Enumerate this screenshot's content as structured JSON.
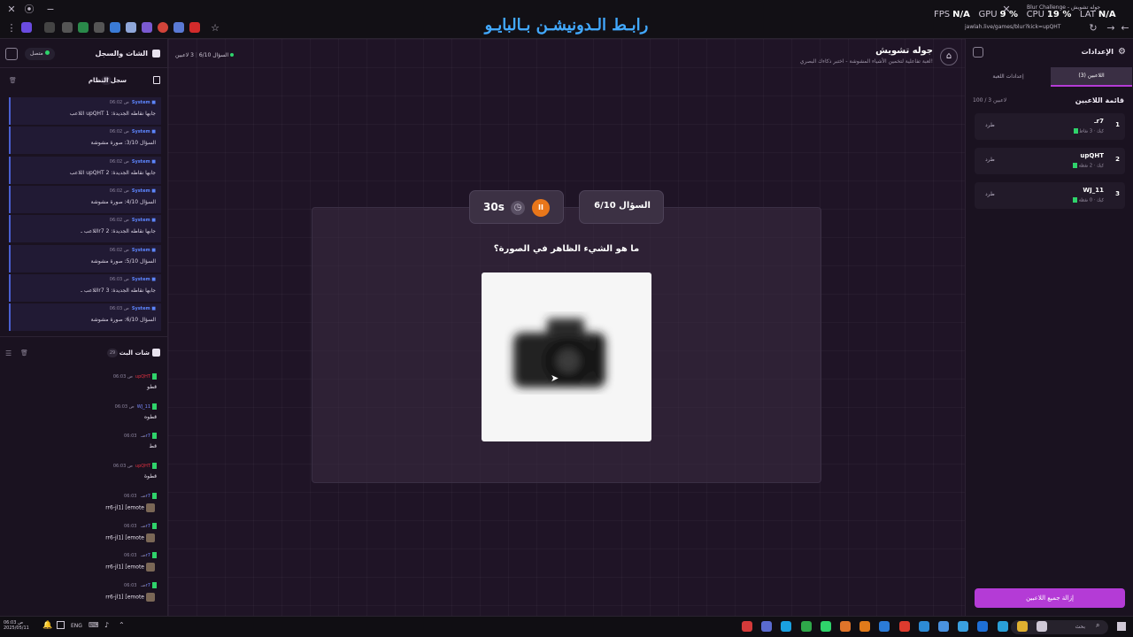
{
  "browser": {
    "banner": "رابـط الـدونيشـن بـالبايـو",
    "tab_title": "Blur Challenge - جوله تشويش",
    "url": "jawlah.live/games/blur?kick=upQHT",
    "stats": {
      "fps_label": "FPS",
      "fps_value": "N/A",
      "gpu_label": "GPU",
      "gpu_value": "9 %",
      "cpu_label": "CPU",
      "cpu_value": "19 %",
      "lat_label": "LAT",
      "lat_value": "N/A"
    }
  },
  "left": {
    "title": "الشات والسجل",
    "status": "متصل",
    "log_title": "سجل النظام",
    "log_count": "17",
    "logs": [
      {
        "time": "06:02 ص",
        "source": "System",
        "text": "اللاعب upQHT جابها نقاطه الجديدة: 1"
      },
      {
        "time": "06:02 ص",
        "source": "System",
        "text": "السؤال 3/10: صورة مشوشة"
      },
      {
        "time": "06:02 ص",
        "source": "System",
        "text": "اللاعب upQHT جابها نقاطه الجديدة: 2"
      },
      {
        "time": "06:02 ص",
        "source": "System",
        "text": "السؤال 4/10: صورة مشوشة"
      },
      {
        "time": "06:02 ص",
        "source": "System",
        "text": "اللاعب ـr7 جابها نقاطه الجديدة: 2"
      },
      {
        "time": "06:02 ص",
        "source": "System",
        "text": "السؤال 5/10: صورة مشوشة"
      },
      {
        "time": "06:03 ص",
        "source": "System",
        "text": "اللاعب ـr7 جابها نقاطه الجديدة: 3"
      },
      {
        "time": "06:03 ص",
        "source": "System",
        "text": "السؤال 6/10: صورة مشوشة"
      }
    ],
    "chat_title": "شات البث",
    "chat_count": "29",
    "chats": [
      {
        "time": "06:03 ص",
        "user": "upQHT",
        "text": "قطو",
        "blue": false
      },
      {
        "time": "06:03 ص",
        "user": "WJ_11",
        "text": "قطوه",
        "blue": true
      },
      {
        "time": "06:03 ص",
        "user": "ـr7",
        "text": "قط",
        "blue": true
      },
      {
        "time": "06:03 ص",
        "user": "upQHT",
        "text": "قطوة",
        "blue": false
      },
      {
        "time": "06:03 ص",
        "user": "ـr7",
        "text": "rr6-jl1] [emote",
        "blue": true
      },
      {
        "time": "06:03 ص",
        "user": "ـr7",
        "text": "rr6-jl1] [emote",
        "blue": true
      },
      {
        "time": "06:03 ص",
        "user": "ـr7",
        "text": "rr6-jl1] [emote",
        "blue": true
      },
      {
        "time": "06:03 ص",
        "user": "ـr7",
        "text": "rr6-jl1] [emote",
        "blue": true
      }
    ]
  },
  "main": {
    "title": "جوله تشويش",
    "subtitle": "لعبة تفاعلية لتخمين الأشياء المشوشة - اختبر ذكاءك البصري!",
    "question_indicator": "السؤال 6/10",
    "players_indicator": "3 لاعبين",
    "timer": "30s",
    "question_pill": "السؤال 6/10",
    "question": "ما هو الشيء الظاهر في الصورة؟"
  },
  "right": {
    "title": "الإعدادات",
    "tab_players": "اللاعبين (3)",
    "tab_settings": "إعدادات اللعبة",
    "list_title": "قائمة اللاعبين",
    "list_count": "100 / 3 لاعبين",
    "kick_label": "طرد",
    "players": [
      {
        "rank": "1",
        "name": "ـr7",
        "score": "3 نقاط",
        "label": "كيك"
      },
      {
        "rank": "2",
        "name": "upQHT",
        "score": "2 نقطة",
        "label": "كيك"
      },
      {
        "rank": "3",
        "name": "WJ_11",
        "score": "0 نقطة",
        "label": "كيك"
      }
    ],
    "remove_all": "إزالة جميع اللاعبين"
  },
  "taskbar": {
    "lang": "ENG",
    "search": "بحث",
    "clock_time": "06:03 ص",
    "clock_date": "2025/05/11"
  },
  "colors": {
    "accent": "#b43bd6",
    "timer_orange": "#e8761a",
    "log_border": "#4a5fd0",
    "kick_green": "#2fd36b"
  }
}
